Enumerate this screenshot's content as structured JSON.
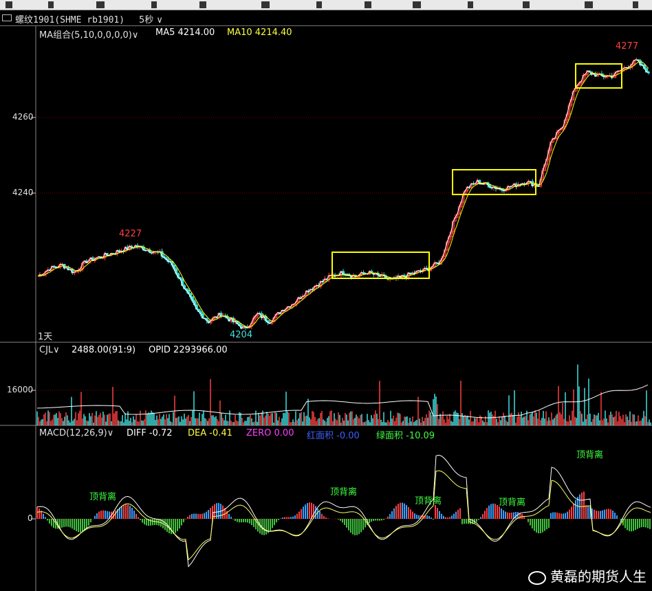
{
  "window": {
    "instrument": "螺纹1901(SHME rb1901)",
    "period": "5秒",
    "period_chevron": "chevron-down-icon"
  },
  "main_panel": {
    "indicator_label": "MA组合(5,10,0,0,0,0)",
    "ma5_label": "MA5 4214.00",
    "ma10_label": "MA10 4214.40",
    "y_ticks": [
      "4260",
      "4240"
    ],
    "timeframe_label": "1天",
    "high_label_1": "4227",
    "low_label": "4204",
    "high_label_2": "4277"
  },
  "volume_panel": {
    "indicator_label": "CJL",
    "value_label": "2488.00(91:9)",
    "opid_label": "OPID 2293966.00",
    "y_tick": "16000"
  },
  "macd_panel": {
    "indicator_label": "MACD(12,26,9)",
    "diff_label": "DIFF -0.72",
    "dea_label": "DEA -0.41",
    "zero_label": "ZERO 0.00",
    "red_area_label": "红面积 -0.00",
    "green_area_label": "绿面积 -10.09",
    "y_tick": "0",
    "divergence_labels": [
      "顶背离",
      "顶背离",
      "顶背离",
      "顶背离",
      "顶背离"
    ]
  },
  "watermark": {
    "text": "黄磊的期货人生"
  },
  "colors": {
    "up": "#ff4040",
    "down": "#40e0e0",
    "ma5": "#ffffff",
    "ma10": "#ffff00",
    "box": "#ffff00",
    "grid": "#8b0000",
    "magenta": "#ff40ff",
    "green": "#40ff40",
    "red_label": "#ff4040",
    "cyan_label": "#40e0e0"
  },
  "chart_data": {
    "type": "line",
    "series": [
      {
        "name": "MA5",
        "values": [
          4218,
          4220,
          4221,
          4219,
          4222,
          4223,
          4224,
          4225,
          4226,
          4225,
          4224,
          4221,
          4215,
          4209,
          4206,
          4208,
          4206,
          4204,
          4208,
          4206,
          4209,
          4211,
          4214,
          4216,
          4218,
          4219,
          4218,
          4219,
          4218,
          4217,
          4218,
          4219,
          4220,
          4222,
          4232,
          4241,
          4243,
          4242,
          4241,
          4242,
          4243,
          4242,
          4253,
          4258,
          4268,
          4272,
          4271,
          4271,
          4273,
          4275,
          4272
        ]
      }
    ],
    "ylim": [
      4200,
      4280
    ],
    "y_ticks": [
      4240,
      4260
    ],
    "highs_marked": [
      4227,
      4277
    ],
    "lows_marked": [
      4204
    ]
  }
}
